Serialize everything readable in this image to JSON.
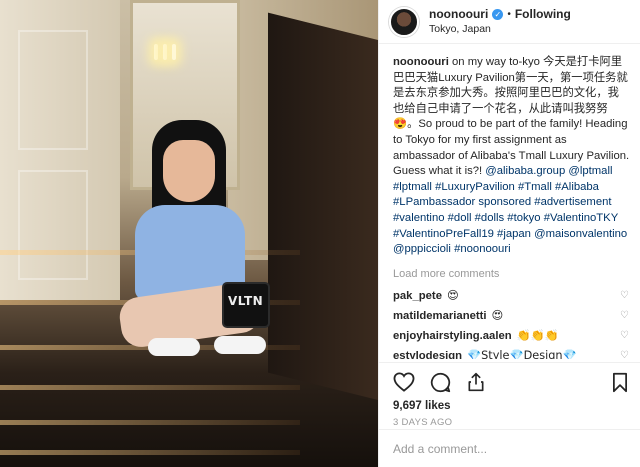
{
  "header": {
    "username": "noonoouri",
    "verified_icon": "verified-badge-icon",
    "separator": "•",
    "follow_status": "Following",
    "location": "Tokyo, Japan"
  },
  "photo": {
    "bag_text": "VLTN"
  },
  "caption": {
    "username": "noonoouri",
    "text": "on my way to-kyo 今天是打卡阿里巴巴天猫Luxury Pavilion第一天，第一项任务就是去东京参加大秀。按照阿里巴巴的文化，我也给自己申请了一个花名，从此请叫我努努😍。So proud to be part of the family! Heading to Tokyo for my first assignment as ambassador of Alibaba's Tmall Luxury Pavilion. Guess what it is?! ",
    "tags": "@alibaba.group @lptmall #lptmall #LuxuryPavilion #Tmall #Alibaba #LPambassador sponsored #advertisement #valentino #doll #dolls #tokyo #ValentinoTKY #ValentinoPreFall19 #japan @maisonvalentino @pppiccioli #noonoouri"
  },
  "load_more": "Load more comments",
  "comments": [
    {
      "user": "pak_pete",
      "text": "😍"
    },
    {
      "user": "matildemarianetti",
      "text": "😍"
    },
    {
      "user": "enjoyhairstyling.aalen",
      "text": "👏👏👏"
    },
    {
      "user": "estylodesign",
      "text": "💎Style💎Design💎"
    }
  ],
  "actions": {
    "like_icon": "heart-icon",
    "comment_icon": "comment-icon",
    "share_icon": "share-icon",
    "save_icon": "bookmark-icon"
  },
  "likes": "9,697 likes",
  "time_ago": "3 DAYS AGO",
  "add_comment": {
    "placeholder": "Add a comment..."
  },
  "colors": {
    "link": "#003569",
    "verified": "#3897f0",
    "muted": "#999999"
  }
}
